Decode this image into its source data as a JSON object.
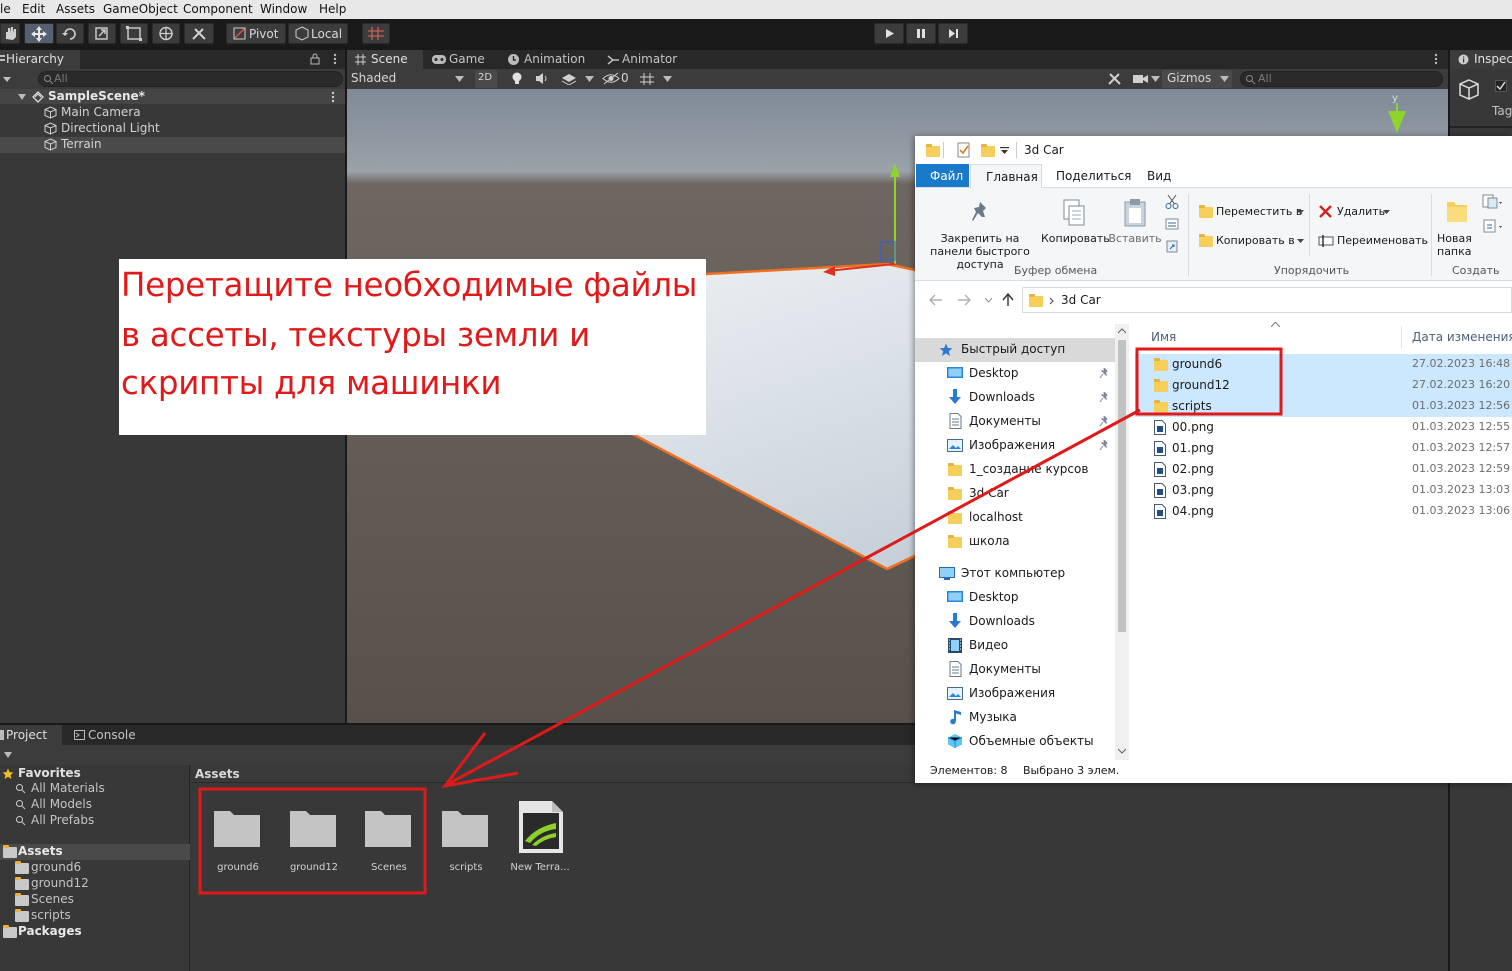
{
  "menubar": {
    "items": [
      "le",
      "Edit",
      "Assets",
      "GameObject",
      "Component",
      "Window",
      "Help"
    ]
  },
  "toolbar": {
    "pivot_label": "Pivot",
    "local_label": "Local"
  },
  "hierarchy": {
    "tab_label": "Hierarchy",
    "search_placeholder": "All",
    "scene_name": "SampleScene*",
    "items": [
      "Main Camera",
      "Directional Light",
      "Terrain"
    ]
  },
  "scene_view": {
    "tabs": [
      "Scene",
      "Game",
      "Animation",
      "Animator"
    ],
    "shading_mode": "Shaded",
    "mode_2d": "2D",
    "hidden_count": "0",
    "gizmos_label": "Gizmos",
    "search_placeholder": "All"
  },
  "inspector": {
    "tab_label": "Inspector",
    "tag_label": "Tag"
  },
  "annotation": {
    "lines": [
      "Перетащите необходимые файлы",
      "в ассеты, текстуры земли и",
      "скрипты для машинки"
    ]
  },
  "explorer": {
    "title": "3d Car",
    "ribbon_tabs": [
      "Файл",
      "Главная",
      "Поделиться",
      "Вид"
    ],
    "clipboard": {
      "pin": "Закрепить на панели быстрого доступа",
      "copy": "Копировать",
      "paste": "Вставить",
      "group": "Буфер обмена"
    },
    "organize": {
      "move_to": "Переместить в",
      "copy_to": "Копировать в",
      "delete": "Удалить",
      "rename": "Переименовать",
      "group": "Упорядочить"
    },
    "create": {
      "new_folder": "Новая папка",
      "group": "Создать"
    },
    "address": "3d Car",
    "columns": {
      "name": "Имя",
      "date": "Дата изменения"
    },
    "nav_quick_access": "Быстрый доступ",
    "nav_quick": [
      "Desktop",
      "Downloads",
      "Документы",
      "Изображения",
      "1_создание курсов",
      "3d Car",
      "localhost",
      "школа"
    ],
    "nav_this_pc": "Этот компьютер",
    "nav_pc": [
      "Desktop",
      "Downloads",
      "Видео",
      "Документы",
      "Изображения",
      "Музыка",
      "Объемные объекты"
    ],
    "files": [
      {
        "name": "ground6",
        "date": "27.02.2023 16:48",
        "kind": "folder",
        "selected": true
      },
      {
        "name": "ground12",
        "date": "27.02.2023 16:20",
        "kind": "folder",
        "selected": true
      },
      {
        "name": "scripts",
        "date": "01.03.2023 12:56",
        "kind": "folder",
        "selected": true
      },
      {
        "name": "00.png",
        "date": "01.03.2023 12:55",
        "kind": "png",
        "selected": false
      },
      {
        "name": "01.png",
        "date": "01.03.2023 12:57",
        "kind": "png",
        "selected": false
      },
      {
        "name": "02.png",
        "date": "01.03.2023 12:59",
        "kind": "png",
        "selected": false
      },
      {
        "name": "03.png",
        "date": "01.03.2023 13:03",
        "kind": "png",
        "selected": false
      },
      {
        "name": "04.png",
        "date": "01.03.2023 13:06",
        "kind": "png",
        "selected": false
      }
    ],
    "status_items": "Элементов: 8",
    "status_selected": "Выбрано 3 элем."
  },
  "project": {
    "tabs": [
      "Project",
      "Console"
    ],
    "favorites_label": "Favorites",
    "favorites": [
      "All Materials",
      "All Models",
      "All Prefabs"
    ],
    "assets_label": "Assets",
    "asset_tree": [
      "ground6",
      "ground12",
      "Scenes",
      "scripts"
    ],
    "packages_label": "Packages",
    "breadcrumb": "Assets",
    "grid_items": [
      {
        "name": "ground6",
        "kind": "folder"
      },
      {
        "name": "ground12",
        "kind": "folder"
      },
      {
        "name": "Scenes",
        "kind": "folder"
      },
      {
        "name": "scripts",
        "kind": "folder"
      },
      {
        "name": "New Terra...",
        "kind": "terrain"
      }
    ]
  },
  "colors": {
    "highlight_red": "#e01a1a",
    "selection_blue": "#cce8ff",
    "unity_dark": "#383838",
    "explorer_accent": "#1979ca"
  }
}
